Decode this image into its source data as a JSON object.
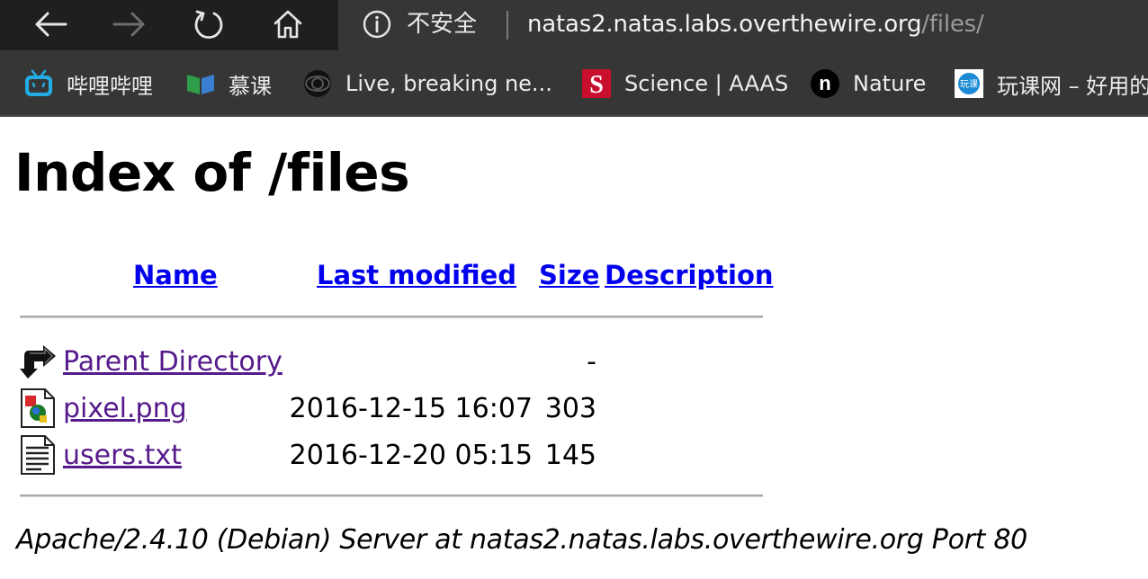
{
  "browser": {
    "security_label": "不安全",
    "url_host": "natas2.natas.labs.overthewire.org",
    "url_path": "/files/"
  },
  "bookmarks": [
    {
      "label": "哔哩哔哩",
      "icon": "bilibili-icon"
    },
    {
      "label": "慕课",
      "icon": "mooc-icon"
    },
    {
      "label": "Live, breaking ne...",
      "icon": "cbs-eye-icon"
    },
    {
      "label": "Science | AAAS",
      "icon": "science-s-icon"
    },
    {
      "label": "Nature",
      "icon": "nature-n-icon"
    },
    {
      "label": "玩课网 – 好用的",
      "icon": "wanke-icon"
    }
  ],
  "page": {
    "title": "Index of /files",
    "columns": {
      "name": "Name",
      "last_modified": "Last modified",
      "size": "Size",
      "description": "Description"
    },
    "rows": [
      {
        "name": "Parent Directory",
        "date": "",
        "size": "-",
        "icon": "back-arrow-icon"
      },
      {
        "name": "pixel.png",
        "date": "2016-12-15 16:07",
        "size": "303",
        "icon": "image-file-icon"
      },
      {
        "name": "users.txt",
        "date": "2016-12-20 05:15",
        "size": "145",
        "icon": "text-file-icon"
      }
    ],
    "footer": "Apache/2.4.10 (Debian) Server at natas2.natas.labs.overthewire.org Port 80"
  },
  "colors": {
    "link": "#0000ee",
    "visited_link": "#551a8b",
    "chrome_dark": "#1f1f1f",
    "chrome_bar": "#363636"
  }
}
